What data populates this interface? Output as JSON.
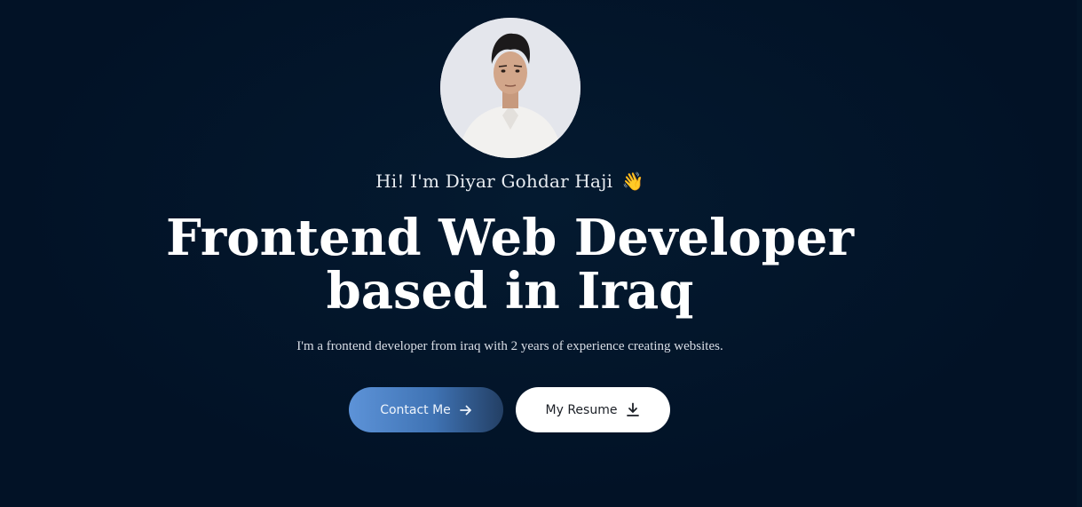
{
  "hero": {
    "greeting": "Hi! I'm Diyar Gohdar Haji",
    "greeting_emoji": "👋",
    "headline_line1": "Frontend Web Developer",
    "headline_line2": "based in Iraq",
    "subtitle": "I'm a frontend developer from iraq with 2 years of experience creating websites."
  },
  "buttons": {
    "contact_label": "Contact Me",
    "contact_icon": "arrow-right-icon",
    "resume_label": "My Resume",
    "resume_icon": "download-icon"
  },
  "colors": {
    "background": "#021226",
    "contact_gradient_start": "#5d93d8",
    "contact_gradient_end": "#233f64",
    "resume_bg": "#ffffff"
  }
}
